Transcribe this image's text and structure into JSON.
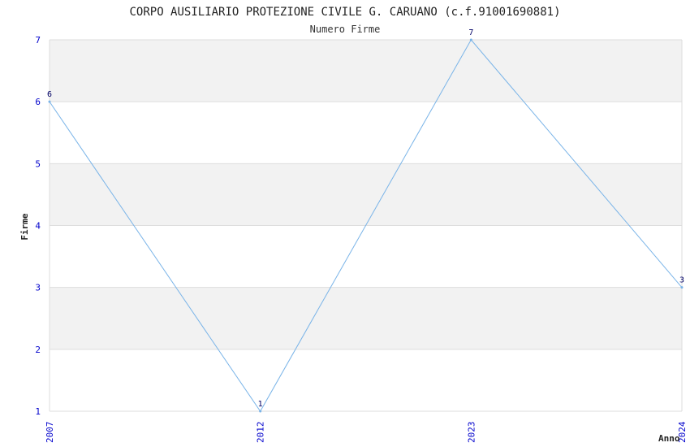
{
  "header": {
    "title": "CORPO AUSILIARIO PROTEZIONE CIVILE G. CARUANO (c.f.91001690881)",
    "subtitle": "Numero Firme"
  },
  "chart_data": {
    "type": "line",
    "title": "CORPO AUSILIARIO PROTEZIONE CIVILE G. CARUANO (c.f.91001690881)",
    "subtitle": "Numero Firme",
    "xlabel": "Anno",
    "ylabel": "Firme",
    "categories": [
      "2007",
      "2012",
      "2023",
      "2024"
    ],
    "series": [
      {
        "values": [
          6,
          1,
          7,
          3
        ]
      }
    ],
    "ylim": [
      1,
      7
    ],
    "yticks": [
      1,
      2,
      3,
      4,
      5,
      6,
      7
    ],
    "grid": true,
    "legend": "none",
    "colors": {
      "line": "#7ab4e8",
      "band": "#f2f2f2",
      "grid": "#dddddd",
      "tick_text": "#0000cc",
      "data_label": "#000066"
    }
  }
}
